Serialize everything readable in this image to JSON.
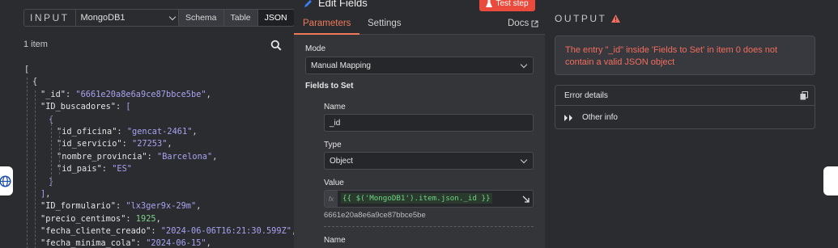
{
  "input": {
    "label": "INPUT",
    "node_selected": "MongoDB1",
    "views": [
      "Schema",
      "Table",
      "JSON"
    ],
    "active_view": "JSON",
    "item_count": "1 item",
    "json_lines": [
      {
        "indent": 0,
        "parts": [
          [
            "p",
            "["
          ]
        ]
      },
      {
        "indent": 1,
        "parts": [
          [
            "p",
            "{"
          ]
        ]
      },
      {
        "indent": 2,
        "parts": [
          [
            "k",
            "\"_id\""
          ],
          [
            "p",
            ": "
          ],
          [
            "s",
            "\"6661e20a8e6a9ce87bbce5be\""
          ],
          [
            "p",
            ","
          ]
        ]
      },
      {
        "indent": 2,
        "parts": [
          [
            "k",
            "\"ID_buscadores\""
          ],
          [
            "p",
            ": "
          ],
          [
            "b",
            "["
          ]
        ]
      },
      {
        "indent": 3,
        "parts": [
          [
            "b",
            "{"
          ]
        ]
      },
      {
        "indent": 4,
        "parts": [
          [
            "k",
            "\"id_oficina\""
          ],
          [
            "p",
            ": "
          ],
          [
            "s",
            "\"gencat-2461\""
          ],
          [
            "p",
            ","
          ]
        ]
      },
      {
        "indent": 4,
        "parts": [
          [
            "k",
            "\"id_servicio\""
          ],
          [
            "p",
            ": "
          ],
          [
            "s",
            "\"27253\""
          ],
          [
            "p",
            ","
          ]
        ]
      },
      {
        "indent": 4,
        "parts": [
          [
            "k",
            "\"nombre_provincia\""
          ],
          [
            "p",
            ": "
          ],
          [
            "s",
            "\"Barcelona\""
          ],
          [
            "p",
            ","
          ]
        ]
      },
      {
        "indent": 4,
        "parts": [
          [
            "k",
            "\"id_pais\""
          ],
          [
            "p",
            ": "
          ],
          [
            "s",
            "\"ES\""
          ]
        ]
      },
      {
        "indent": 3,
        "parts": [
          [
            "b",
            "}"
          ]
        ]
      },
      {
        "indent": 2,
        "parts": [
          [
            "b",
            "]"
          ],
          [
            "p",
            ","
          ]
        ]
      },
      {
        "indent": 2,
        "parts": [
          [
            "k",
            "\"ID_formulario\""
          ],
          [
            "p",
            ": "
          ],
          [
            "s",
            "\"lx3ger9x-29m\""
          ],
          [
            "p",
            ","
          ]
        ]
      },
      {
        "indent": 2,
        "parts": [
          [
            "k",
            "\"precio_centimos\""
          ],
          [
            "p",
            ": "
          ],
          [
            "n",
            "1925"
          ],
          [
            "p",
            ","
          ]
        ]
      },
      {
        "indent": 2,
        "parts": [
          [
            "k",
            "\"fecha_cliente_creado\""
          ],
          [
            "p",
            ": "
          ],
          [
            "s",
            "\"2024-06-06T16:21:30.599Z\""
          ],
          [
            "p",
            ","
          ]
        ]
      },
      {
        "indent": 2,
        "parts": [
          [
            "k",
            "\"fecha_minima_cola\""
          ],
          [
            "p",
            ": "
          ],
          [
            "s",
            "\"2024-06-15\""
          ],
          [
            "p",
            ","
          ]
        ]
      }
    ]
  },
  "editor": {
    "title": "Edit Fields",
    "test_button": "Test step",
    "tabs": [
      "Parameters",
      "Settings"
    ],
    "docs": "Docs",
    "mode_label": "Mode",
    "mode_value": "Manual Mapping",
    "fields_to_set": "Fields to Set",
    "name_label": "Name",
    "name_value": "_id",
    "type_label": "Type",
    "type_value": "Object",
    "value_label": "Value",
    "fx": "fx",
    "value_expr": "{{ $('MongoDB1').item.json._id }}",
    "value_preview": "6661e20a8e6a9ce87bbce5be",
    "name2_label": "Name"
  },
  "output": {
    "label": "OUTPUT",
    "error_message": "The entry \"_id\" inside 'Fields to Set' in item 0 does not contain a valid JSON object",
    "details_title": "Error details",
    "other_info": "Other info"
  },
  "colors": {
    "accent": "#ef7a59",
    "test_button": "#ea4b3c",
    "error_text": "#f26d5d",
    "json_string": "#a9a3f0",
    "json_number": "#7fd18e"
  }
}
